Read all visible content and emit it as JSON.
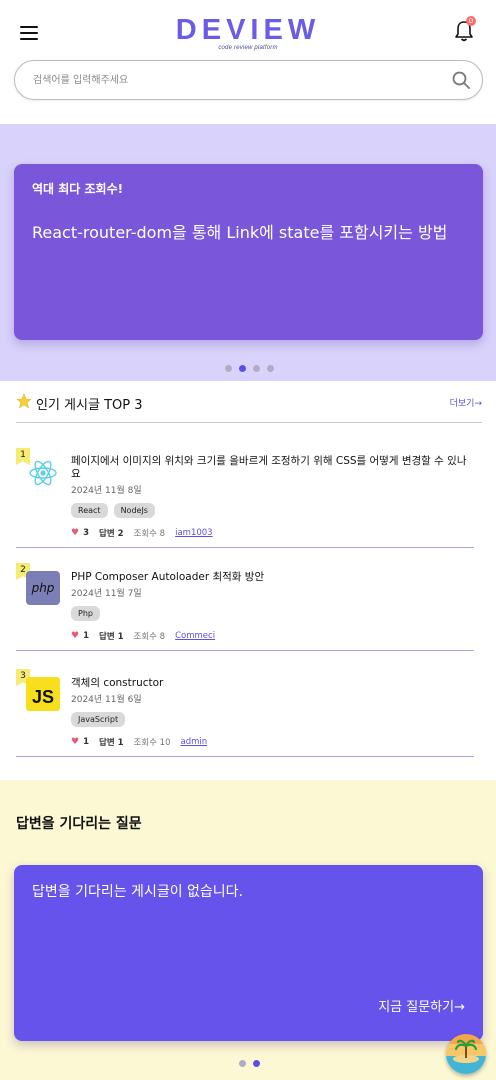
{
  "header": {
    "logo": "DEVIEW",
    "logo_sub": "code review platform",
    "notification_count": "0",
    "search_placeholder": "검색어를 입력해주세요"
  },
  "hero": {
    "label": "역대 최다 조회수!",
    "title": "React-router-dom을 통해 Link에 state를 포함시키는 방법",
    "active_dot": 2,
    "dot_count": 4
  },
  "popular": {
    "title": "인기 게시글 TOP 3",
    "more": "더보기→",
    "posts": [
      {
        "rank": "1",
        "icon": "react-icon",
        "title": "페이지에서 이미지의 위치와 크기를 올바르게 조정하기 위해 CSS를 어떻게 변경할 수 있나요",
        "date": "2024년 11월 8일",
        "tags": [
          "React",
          "NodeJs"
        ],
        "likes": "3",
        "answers": "답변 2",
        "views": "조회수 8",
        "author": "iam1003"
      },
      {
        "rank": "2",
        "icon": "php-icon",
        "title": "PHP Composer Autoloader 최적화 방안",
        "date": "2024년 11월 7일",
        "tags": [
          "Php"
        ],
        "likes": "1",
        "answers": "답변 1",
        "views": "조회수 8",
        "author": "Commeci"
      },
      {
        "rank": "3",
        "icon": "javascript-icon",
        "title": "객체의 constructor",
        "date": "2024년 11월 6일",
        "tags": [
          "JavaScript"
        ],
        "likes": "1",
        "answers": "답변 1",
        "views": "조회수 10",
        "author": "admin"
      }
    ]
  },
  "waiting": {
    "title": "답변을 기다리는 질문",
    "message": "답변을 기다리는 게시글이 없습니다.",
    "ask_link": "지금 질문하기→",
    "active_dot": 2,
    "dot_count": 2
  },
  "colors": {
    "brand": "#6b5ce7",
    "hero_bg": "#d9d3fb",
    "hero_card": "#7a57da",
    "waiting_bg": "#fcf8d3",
    "waiting_card": "#6653ec"
  }
}
